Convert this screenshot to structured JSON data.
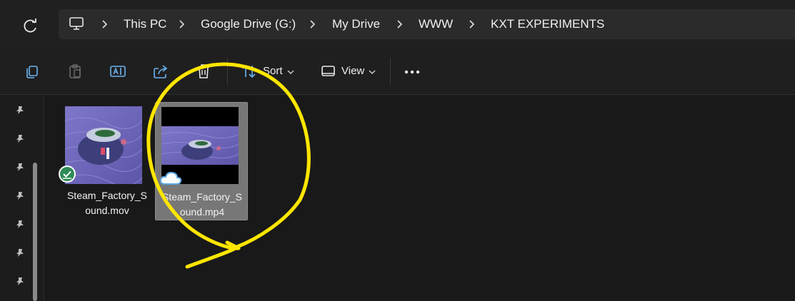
{
  "breadcrumb": {
    "items": [
      "This PC",
      "Google Drive (G:)",
      "My Drive",
      "WWW",
      "KXT EXPERIMENTS"
    ]
  },
  "toolbar": {
    "sort_label": "Sort",
    "view_label": "View"
  },
  "files": [
    {
      "name_line1": "Steam_Factory_S",
      "name_line2": "ound.mov",
      "status": "synced",
      "selected": false
    },
    {
      "name_line1": "Steam_Factory_S",
      "name_line2": "ound.mp4",
      "status": "cloud-only",
      "selected": true
    }
  ],
  "colors": {
    "annotation": "#ffe600",
    "synced_badge": "#2e8b57",
    "cloud_icon": "#5ba8e6"
  }
}
